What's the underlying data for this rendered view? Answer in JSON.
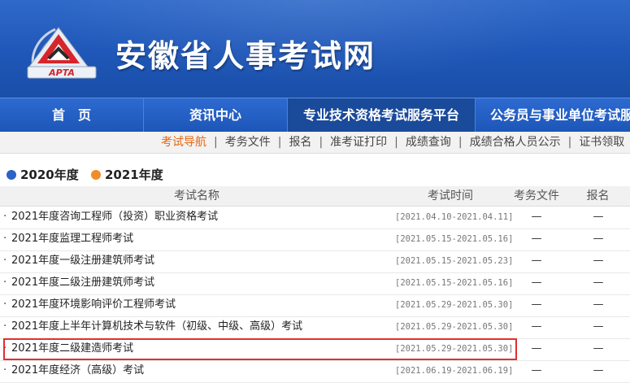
{
  "header": {
    "logo_text": "APTA",
    "site_title": "安徽省人事考试网"
  },
  "main_nav": {
    "items": [
      {
        "label": "首　页"
      },
      {
        "label": "资讯中心"
      },
      {
        "label": "专业技术资格考试服务平台"
      },
      {
        "label": "公务员与事业单位考试服务平台"
      }
    ],
    "active_index": 2
  },
  "sub_nav": {
    "items": [
      {
        "label": "考试导航"
      },
      {
        "label": "考务文件"
      },
      {
        "label": "报名"
      },
      {
        "label": "准考证打印"
      },
      {
        "label": "成绩查询"
      },
      {
        "label": "成绩合格人员公示"
      },
      {
        "label": "证书领取"
      }
    ],
    "separator": "|",
    "active_index": 0
  },
  "year_tabs": [
    {
      "label": "2020年度",
      "color": "#2d62c8"
    },
    {
      "label": "2021年度",
      "color": "#f08c2a"
    }
  ],
  "table": {
    "headers": {
      "name": "考试名称",
      "time": "考试时间",
      "files": "考务文件",
      "register": "报名"
    },
    "bullet": "·",
    "rows": [
      {
        "name": "2021年度咨询工程师（投资）职业资格考试",
        "time": "[2021.04.10-2021.04.11]",
        "files": "—",
        "register": "—"
      },
      {
        "name": "2021年度监理工程师考试",
        "time": "[2021.05.15-2021.05.16]",
        "files": "—",
        "register": "—"
      },
      {
        "name": "2021年度一级注册建筑师考试",
        "time": "[2021.05.15-2021.05.23]",
        "files": "—",
        "register": "—"
      },
      {
        "name": "2021年度二级注册建筑师考试",
        "time": "[2021.05.15-2021.05.16]",
        "files": "—",
        "register": "—"
      },
      {
        "name": "2021年度环境影响评价工程师考试",
        "time": "[2021.05.29-2021.05.30]",
        "files": "—",
        "register": "—"
      },
      {
        "name": "2021年度上半年计算机技术与软件（初级、中级、高级）考试",
        "time": "[2021.05.29-2021.05.30]",
        "files": "—",
        "register": "—"
      },
      {
        "name": "2021年度二级建造师考试",
        "time": "[2021.05.29-2021.05.30]",
        "files": "—",
        "register": "—"
      },
      {
        "name": "2021年度经济（高级）考试",
        "time": "[2021.06.19-2021.06.19]",
        "files": "—",
        "register": "—"
      }
    ],
    "highlighted_row_index": 6,
    "highlight_color": "#e03030"
  }
}
